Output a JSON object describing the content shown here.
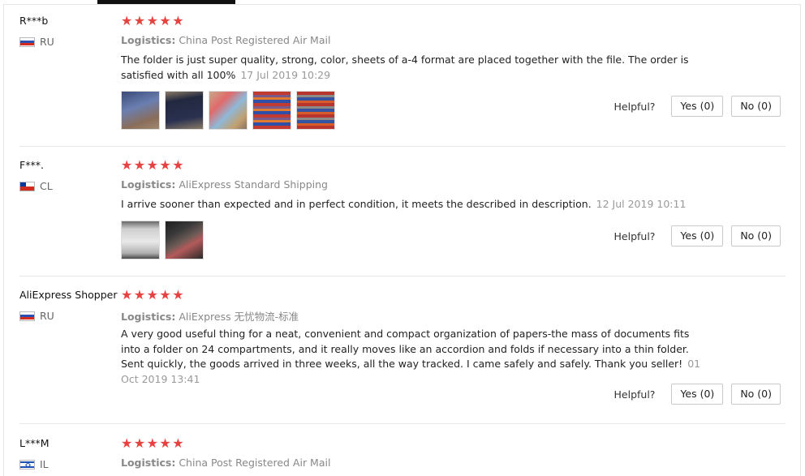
{
  "labels": {
    "logistics": "Logistics:",
    "helpful": "Helpful?"
  },
  "colors": {
    "star": "#e64340"
  },
  "reviews": [
    {
      "user": "R***b",
      "country": "RU",
      "flag": "russia",
      "stars": [
        "★",
        "★",
        "★",
        "★",
        "★"
      ],
      "logistics": "China Post Registered Air Mail",
      "feedback": "The folder is just super quality, strong, color, sheets of a-4 format are placed together with the file. The order is satisfied with all 100%",
      "date": "17 Jul 2019 10:29",
      "photos": [
        "review-photo-1",
        "review-photo-2",
        "review-photo-3",
        "review-photo-4",
        "review-photo-5"
      ],
      "yes_label": "Yes (0)",
      "no_label": "No (0)"
    },
    {
      "user": "F***.",
      "country": "CL",
      "flag": "chile",
      "stars": [
        "★",
        "★",
        "★",
        "★",
        "★"
      ],
      "logistics": "AliExpress Standard Shipping",
      "feedback": "I arrive sooner than expected and in perfect condition, it meets the described in description.",
      "date": "12 Jul 2019 10:11",
      "photos": [
        "review-photo-1",
        "review-photo-2"
      ],
      "yes_label": "Yes (0)",
      "no_label": "No (0)"
    },
    {
      "user": "AliExpress Shopper",
      "country": "RU",
      "flag": "russia",
      "stars": [
        "★",
        "★",
        "★",
        "★",
        "★"
      ],
      "logistics": "AliExpress 无忧物流-标准",
      "feedback": "A very good useful thing for a neat, convenient and compact organization of papers-the mass of documents fits into a folder on 24 compartments, and it really moves like an accordion and folds if necessary into a thin folder. Sent quickly, the goods arrived in three weeks, all the way tracked. I came safely and safely. Thank you seller!",
      "date": "01 Oct 2019 13:41",
      "photos": [],
      "yes_label": "Yes (0)",
      "no_label": "No (0)"
    },
    {
      "user": "L***M",
      "country": "IL",
      "flag": "israel",
      "stars": [
        "★",
        "★",
        "★",
        "★",
        "★"
      ],
      "logistics": "China Post Registered Air Mail"
    }
  ]
}
